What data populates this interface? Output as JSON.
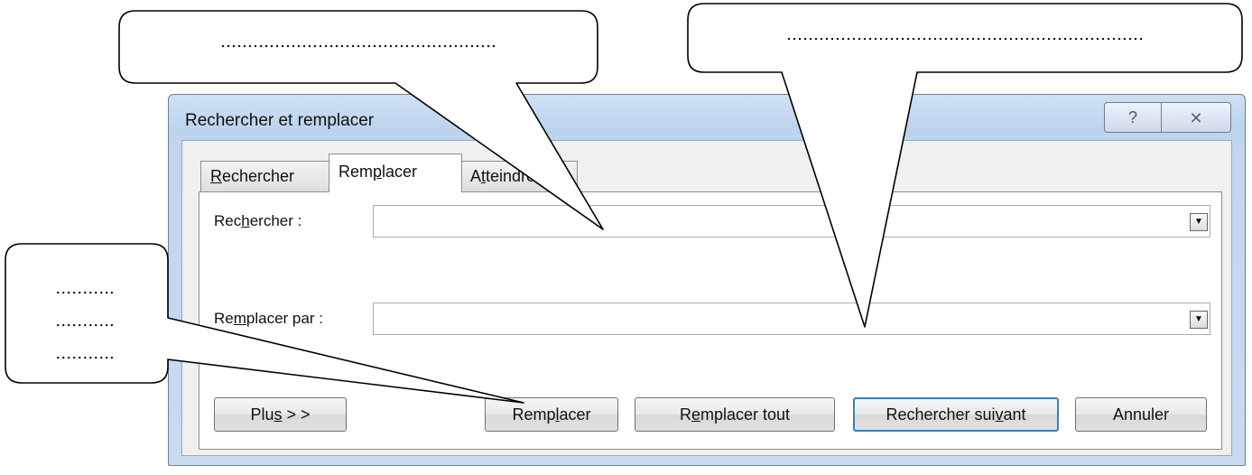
{
  "dialog": {
    "title": "Rechercher et remplacer",
    "help_glyph": "?",
    "close_glyph": "⨯",
    "tabs": [
      {
        "pre": "",
        "key": "R",
        "post": "echercher"
      },
      {
        "pre": "Rem",
        "key": "p",
        "post": "lacer"
      },
      {
        "pre": "A",
        "key": "t",
        "post": "teindre"
      }
    ],
    "find_label": {
      "pre": "Rec",
      "key": "h",
      "post": "ercher :"
    },
    "find_value": "",
    "replace_label": {
      "pre": "Re",
      "key": "m",
      "post": "placer par :"
    },
    "replace_value": "",
    "dropdown_glyph": "▼",
    "buttons": {
      "plus": {
        "pre": "Plu",
        "key": "s",
        "post": " > >"
      },
      "replace": {
        "pre": "Remp",
        "key": "l",
        "post": "acer"
      },
      "replace_all": {
        "pre": "R",
        "key": "e",
        "post": "mplacer tout"
      },
      "find_next": {
        "pre": "Rechercher sui",
        "key": "v",
        "post": "ant"
      },
      "cancel": {
        "pre": "Annuler",
        "key": "",
        "post": ""
      }
    }
  },
  "callouts": {
    "top_left": "……………………………………………",
    "top_right": "…………………………………………………………",
    "left": [
      "………..",
      "………..",
      "……….."
    ]
  },
  "colors": {
    "frame": "#bcd3ee",
    "default_button_border": "#3c7fb1"
  }
}
